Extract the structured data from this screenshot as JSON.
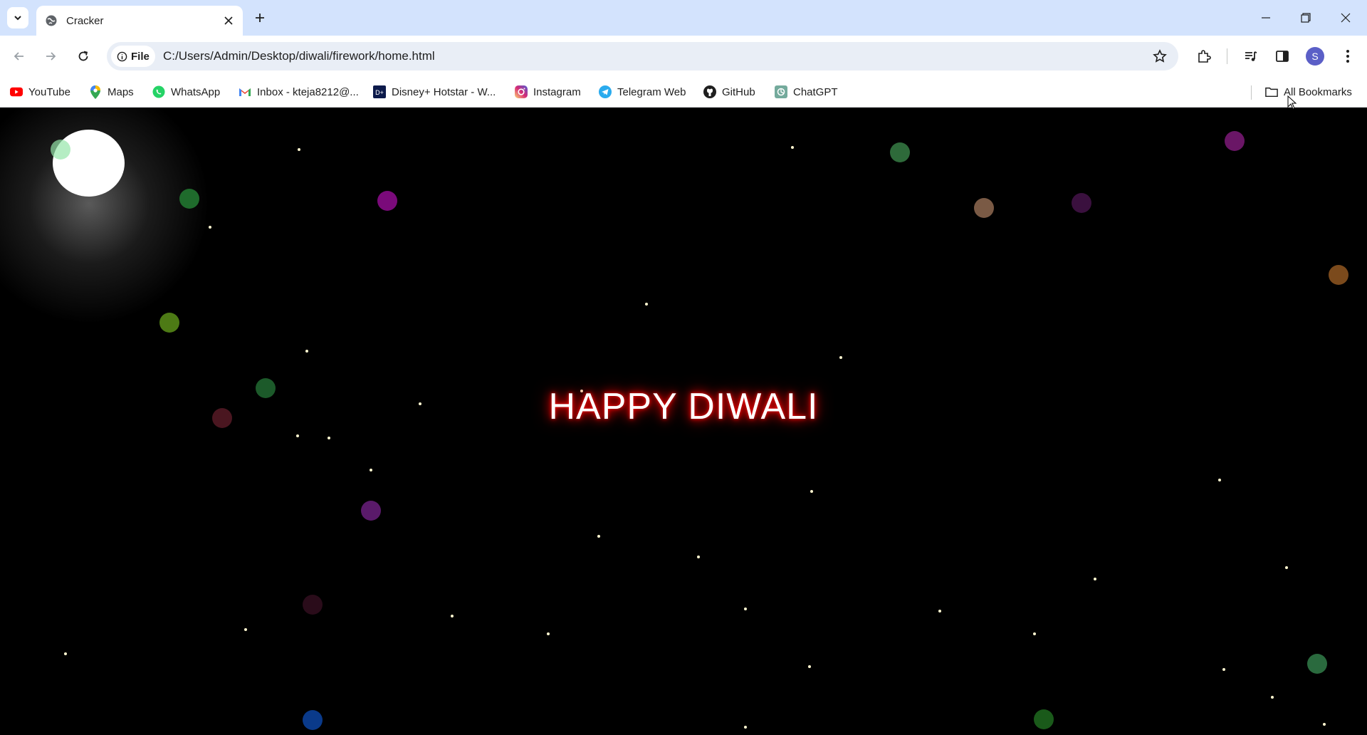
{
  "browser": {
    "tab": {
      "title": "Cracker"
    },
    "address_bar": {
      "scheme_label": "File",
      "url": "C:/Users/Admin/Desktop/diwali/firework/home.html"
    },
    "profile_initial": "S",
    "bookmarks": [
      {
        "label": "YouTube",
        "icon": "youtube-icon"
      },
      {
        "label": "Maps",
        "icon": "maps-icon"
      },
      {
        "label": "WhatsApp",
        "icon": "whatsapp-icon"
      },
      {
        "label": "Inbox - kteja8212@...",
        "icon": "gmail-icon"
      },
      {
        "label": "Disney+ Hotstar - W...",
        "icon": "hotstar-icon"
      },
      {
        "label": "Instagram",
        "icon": "instagram-icon"
      },
      {
        "label": "Telegram Web",
        "icon": "telegram-icon"
      },
      {
        "label": "GitHub",
        "icon": "github-icon"
      },
      {
        "label": "ChatGPT",
        "icon": "chatgpt-icon"
      }
    ],
    "all_bookmarks_label": "All Bookmarks"
  },
  "page": {
    "greeting": "HAPPY DIWALI",
    "colors": {
      "background": "#000000",
      "glow": "#ff0000",
      "moon": "#ffffff"
    }
  }
}
